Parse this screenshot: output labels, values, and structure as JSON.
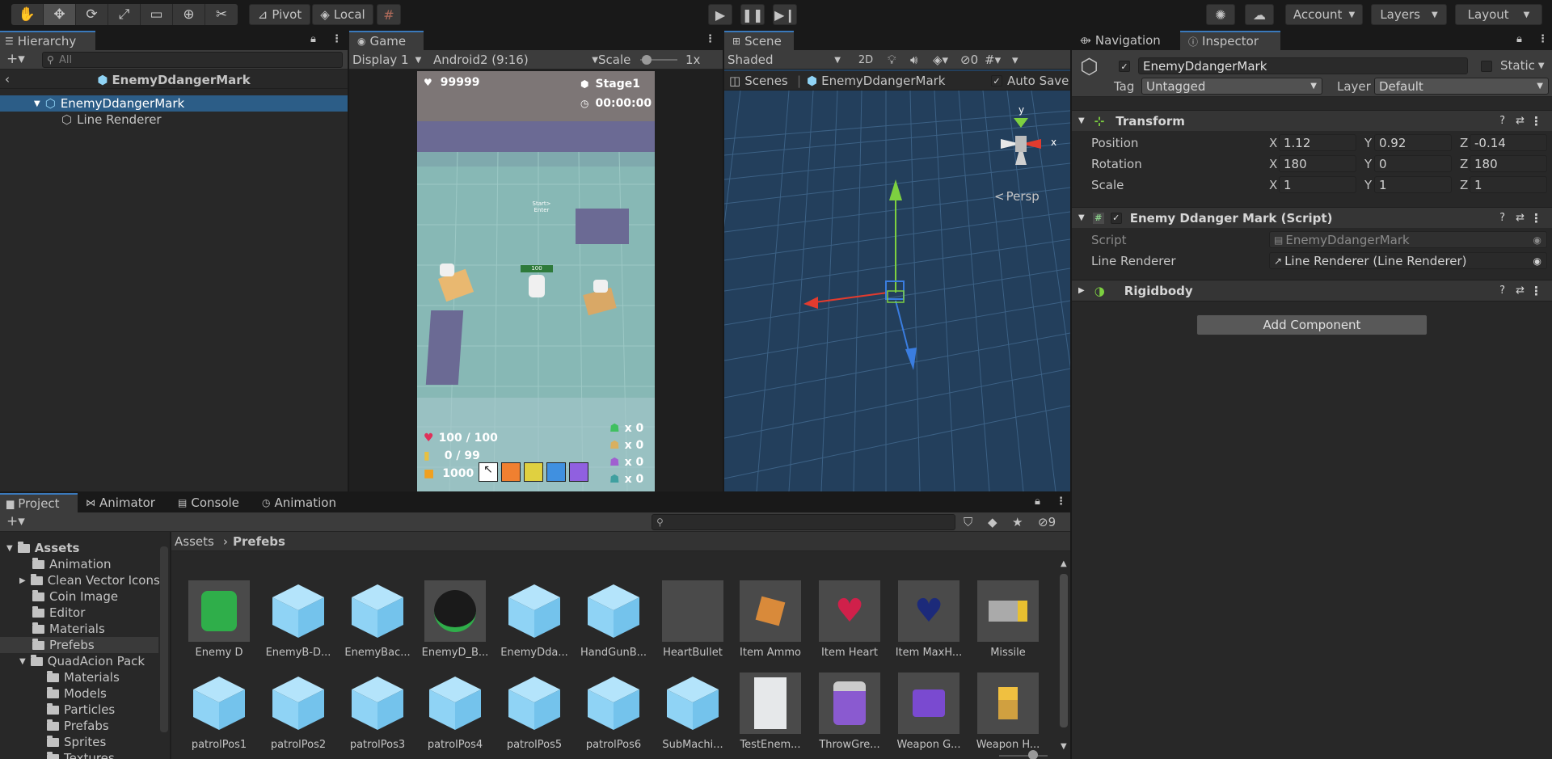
{
  "toolbar": {
    "pivot": "Pivot",
    "local": "Local",
    "account": "Account",
    "layers": "Layers",
    "layout": "Layout"
  },
  "hierarchy": {
    "tab": "Hierarchy",
    "search_placeholder": "All",
    "breadcrumb": "EnemyDdangerMark",
    "root": "EnemyDdangerMark",
    "child": "Line Renderer"
  },
  "game": {
    "tab": "Game",
    "display": "Display 1",
    "resolution": "Android2 (9:16)",
    "scale_label": "Scale",
    "scale_value": "1x",
    "score": "99999",
    "stage": "Stage1",
    "timer": "00:00:00",
    "start_text": "Start>\nEnter",
    "enemy_hp_label": "100",
    "hp": "100 / 100",
    "ammo": "0 / 99",
    "coins": "1000",
    "counters": [
      "x 0",
      "x 0",
      "x 0",
      "x 0"
    ]
  },
  "scene": {
    "tab": "Scene",
    "shading": "Shaded",
    "mode_2d": "2D",
    "hidden_count": "0",
    "breadcrumb_root": "Scenes",
    "breadcrumb_obj": "EnemyDdangerMark",
    "auto_save": "Auto Save",
    "gizmo_y": "y",
    "gizmo_x": "x",
    "persp": "Persp"
  },
  "inspector": {
    "tab_nav": "Navigation",
    "tab_insp": "Inspector",
    "object_name": "EnemyDdangerMark",
    "static": "Static",
    "tag_label": "Tag",
    "tag_value": "Untagged",
    "layer_label": "Layer",
    "layer_value": "Default",
    "transform": {
      "title": "Transform",
      "position_label": "Position",
      "rotation_label": "Rotation",
      "scale_label": "Scale",
      "px": "1.12",
      "py": "0.92",
      "pz": "-0.14",
      "rx": "180",
      "ry": "0",
      "rz": "180",
      "sx": "1",
      "sy": "1",
      "sz": "1"
    },
    "script_comp": {
      "title": "Enemy Ddanger Mark (Script)",
      "script_label": "Script",
      "script_value": "EnemyDdangerMark",
      "line_label": "Line Renderer",
      "line_value": "Line Renderer (Line Renderer)"
    },
    "rigidbody": "Rigidbody",
    "add_component": "Add Component"
  },
  "project": {
    "tabs": [
      "Project",
      "Animator",
      "Console",
      "Animation"
    ],
    "hidden_count": "9",
    "breadcrumb_root": "Assets",
    "breadcrumb_current": "Prefebs",
    "tree": [
      "Assets",
      "Animation",
      "Clean Vector Icons",
      "Coin Image",
      "Editor",
      "Materials",
      "Prefebs",
      "QuadAcion Pack",
      "Materials",
      "Models",
      "Particles",
      "Prefabs",
      "Sprites",
      "Textures"
    ],
    "assets_row1": [
      "Enemy D",
      "EnemyB-D...",
      "EnemyBac...",
      "EnemyD_B...",
      "EnemyDda...",
      "HandGunB...",
      "HeartBullet",
      "Item Ammo",
      "Item Heart",
      "Item MaxH...",
      "Missile"
    ],
    "assets_row2": [
      "patrolPos1",
      "patrolPos2",
      "patrolPos3",
      "patrolPos4",
      "patrolPos5",
      "patrolPos6",
      "SubMachi...",
      "TestEnem...",
      "ThrowGre...",
      "Weapon G...",
      "Weapon H..."
    ]
  },
  "colors": {
    "selection": "#2c5d87",
    "accent": "#3a79bb",
    "cube": "#8fd3f5",
    "scene_bg": "#233f5c",
    "game_floor": "#87b8b5"
  }
}
